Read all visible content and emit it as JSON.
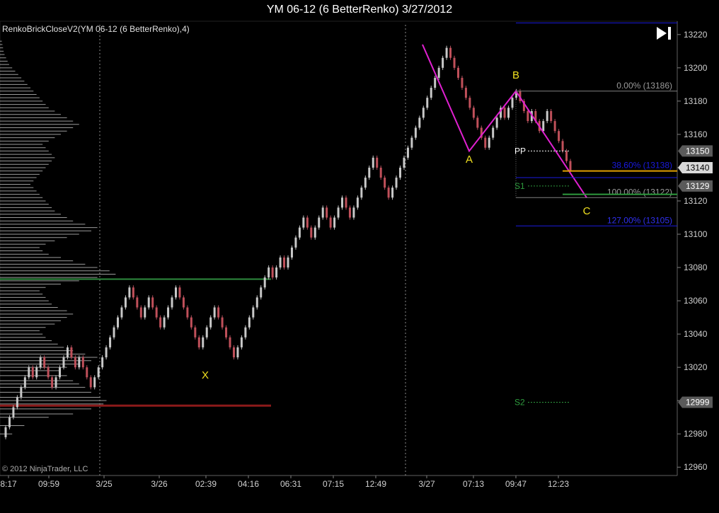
{
  "window": {
    "title": "YM 06-12 (6 BetterRenko)  3/27/2012"
  },
  "copyright": "© 2012 NinjaTrader, LLC",
  "colors": {
    "up": "#c8c8c8",
    "down": "#c0505a",
    "pattern": "#e020d0",
    "profile": "#9a9a9a",
    "poc": "#8b1a1a",
    "val": "#2e8b3e",
    "fib_blue": "#1a1ae0",
    "orange": "#e0a000",
    "green_line": "#2e9b3e"
  },
  "chart_data": {
    "type": "renko",
    "title": "YM 06-12 (6 BetterRenko)  3/27/2012",
    "indicator_label": "RenkoBrickCloseV2(YM 06-12 (6 BetterRenko),4)",
    "ylim": [
      12955,
      13228
    ],
    "y_ticks": [
      12960,
      12980,
      13000,
      13020,
      13040,
      13060,
      13080,
      13100,
      13120,
      13140,
      13160,
      13180,
      13200,
      13220
    ],
    "x_tick_labels": [
      "8:17",
      "09:59",
      "3/25",
      "3/26",
      "02:39",
      "04:16",
      "06:31",
      "07:15",
      "12:49",
      "3/27",
      "07:13",
      "09:47",
      "12:23"
    ],
    "price_markers": [
      {
        "value": 13150,
        "label": "13150",
        "style": "gray"
      },
      {
        "value": 13140,
        "label": "13140",
        "style": "light"
      },
      {
        "value": 13129,
        "label": "13129",
        "style": "gray"
      },
      {
        "value": 12999,
        "label": "12999",
        "style": "gray"
      }
    ],
    "bricks": [
      12984,
      12990,
      12996,
      13002,
      13008,
      13014,
      13020,
      13014,
      13020,
      13026,
      13020,
      13014,
      13008,
      13014,
      13020,
      13026,
      13032,
      13026,
      13020,
      13026,
      13020,
      13014,
      13008,
      13014,
      13020,
      13026,
      13032,
      13038,
      13044,
      13050,
      13056,
      13062,
      13068,
      13062,
      13056,
      13050,
      13056,
      13062,
      13056,
      13050,
      13044,
      13050,
      13056,
      13062,
      13068,
      13062,
      13056,
      13050,
      13044,
      13038,
      13032,
      13038,
      13044,
      13050,
      13056,
      13050,
      13044,
      13038,
      13032,
      13026,
      13032,
      13038,
      13044,
      13050,
      13056,
      13062,
      13068,
      13074,
      13080,
      13074,
      13080,
      13086,
      13080,
      13086,
      13092,
      13098,
      13104,
      13110,
      13104,
      13098,
      13104,
      13110,
      13116,
      13110,
      13104,
      13110,
      13116,
      13122,
      13116,
      13110,
      13116,
      13122,
      13128,
      13134,
      13140,
      13146,
      13140,
      13134,
      13128,
      13122,
      13128,
      13134,
      13140,
      13146,
      13152,
      13158,
      13164,
      13170,
      13176,
      13182,
      13188,
      13194,
      13200,
      13206,
      13212,
      13206,
      13200,
      13194,
      13188,
      13182,
      13176,
      13170,
      13164,
      13158,
      13152,
      13158,
      13164,
      13170,
      13176,
      13170,
      13176,
      13182,
      13186,
      13180,
      13174,
      13168,
      13174,
      13168,
      13162,
      13168,
      13174,
      13168,
      13162,
      13156,
      13150,
      13144,
      13138
    ],
    "profile": [
      12980,
      12985,
      12990,
      12992,
      12995,
      12998,
      13000,
      13002,
      13005,
      13008,
      13010,
      13012,
      13015,
      13018,
      13020,
      13022,
      13024,
      13026,
      13028,
      13030,
      13032,
      13034,
      13036,
      13038,
      13040,
      13042,
      13044,
      13046,
      13048,
      13050,
      13052,
      13054,
      13056,
      13058,
      13060,
      13062,
      13064,
      13066,
      13068,
      13070,
      13072,
      13074,
      13076,
      13078,
      13080,
      13082,
      13084,
      13086,
      13088,
      13090,
      13092,
      13094,
      13096,
      13098,
      13100,
      13102,
      13104,
      13106,
      13108,
      13110,
      13112,
      13114,
      13116,
      13118,
      13120,
      13122,
      13124,
      13126,
      13128,
      13130,
      13132,
      13134,
      13136,
      13138,
      13140,
      13142,
      13144,
      13146,
      13148,
      13150,
      13152,
      13154,
      13156,
      13158,
      13160,
      13162,
      13164,
      13166,
      13168,
      13170,
      13172,
      13174,
      13176,
      13178,
      13180,
      13182,
      13184,
      13186,
      13188,
      13190,
      13192,
      13194,
      13196,
      13198,
      13200,
      13202,
      13204,
      13206,
      13208,
      13210,
      13212,
      13214,
      13216
    ],
    "profile_widths": [
      40,
      80,
      160,
      240,
      300,
      340,
      350,
      330,
      300,
      280,
      260,
      240,
      220,
      200,
      220,
      260,
      300,
      320,
      280,
      240,
      210,
      190,
      170,
      150,
      140,
      130,
      150,
      180,
      200,
      220,
      240,
      220,
      190,
      170,
      160,
      150,
      140,
      130,
      150,
      200,
      260,
      320,
      380,
      360,
      320,
      280,
      240,
      200,
      160,
      140,
      130,
      150,
      180,
      220,
      260,
      300,
      320,
      280,
      240,
      220,
      200,
      180,
      170,
      160,
      150,
      140,
      130,
      120,
      110,
      100,
      110,
      120,
      130,
      140,
      150,
      160,
      170,
      180,
      170,
      160,
      150,
      140,
      160,
      180,
      200,
      220,
      240,
      260,
      240,
      220,
      200,
      180,
      160,
      150,
      140,
      130,
      120,
      110,
      100,
      90,
      80,
      70,
      60,
      50,
      40,
      30,
      25,
      20,
      15,
      12,
      10,
      8,
      6
    ],
    "profile_lines": [
      {
        "value": 12997,
        "kind": "poc"
      },
      {
        "value": 13073,
        "kind": "val"
      }
    ],
    "pattern": {
      "points": [
        {
          "label": "X",
          "value": 13026
        },
        {
          "label": "A",
          "value": 13150
        },
        {
          "label": "B",
          "value": 13186
        },
        {
          "label": "C",
          "value": 13122
        }
      ],
      "lines": [
        {
          "value": 13186,
          "label": "0.00% (13186)",
          "color": "gray"
        },
        {
          "value": 13138,
          "label": "38.60% (13138)",
          "color": "orange"
        },
        {
          "value": 13122,
          "label": "100.00% (13122)",
          "color": "gray"
        },
        {
          "value": 13105,
          "label": "127.00% (13105)",
          "color": "blue"
        },
        {
          "value": 13227,
          "label": "",
          "color": "blue"
        },
        {
          "value": 13134,
          "label": "",
          "color": "blue"
        }
      ],
      "pivots": [
        {
          "label": "PP",
          "value": 13150
        },
        {
          "label": "S1",
          "value": 13129
        },
        {
          "label": "S2",
          "value": 12999
        }
      ]
    }
  }
}
